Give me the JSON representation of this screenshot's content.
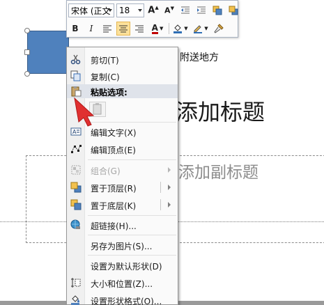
{
  "slide": {
    "title_placeholder": "添加标题",
    "subtitle_placeholder": "添加副标题",
    "shape_text": "附送地方"
  },
  "mini_toolbar": {
    "font_name": "宋体 (正文",
    "font_size": "18",
    "buttons": [
      "A▲",
      "A▼",
      "decrease-indent",
      "increase-indent",
      "bring-forward",
      "send-backward",
      "B",
      "I",
      "align-left",
      "align-center",
      "align-right",
      "A",
      "fill-color",
      "outline-color",
      "format-painter"
    ],
    "bold_label": "B",
    "italic_label": "I",
    "font_color_label": "A",
    "grow_label": "A",
    "shrink_label": "A",
    "font_color": "#c00000",
    "active_button": "align-center"
  },
  "context_menu": {
    "items": [
      {
        "label": "剪切(T)",
        "icon": "scissors-icon",
        "enabled": true
      },
      {
        "label": "复制(C)",
        "icon": "copy-icon",
        "enabled": true
      },
      {
        "label": "粘贴选项:",
        "icon": "paste-icon",
        "enabled": true,
        "header": true
      },
      {
        "label": "编辑文字(X)",
        "icon": "edit-text-icon",
        "enabled": true
      },
      {
        "label": "编辑顶点(E)",
        "icon": "edit-points-icon",
        "enabled": true
      },
      {
        "label": "组合(G)",
        "icon": "group-icon",
        "enabled": false,
        "submenu": true
      },
      {
        "label": "置于顶层(R)",
        "icon": "bring-to-front-icon",
        "enabled": true,
        "submenu": true
      },
      {
        "label": "置于底层(K)",
        "icon": "send-to-back-icon",
        "enabled": true,
        "submenu": true
      },
      {
        "label": "超链接(H)...",
        "icon": "hyperlink-icon",
        "enabled": true
      },
      {
        "label": "另存为图片(S)...",
        "icon": "",
        "enabled": true
      },
      {
        "label": "设置为默认形状(D)",
        "icon": "",
        "enabled": true
      },
      {
        "label": "大小和位置(Z)...",
        "icon": "size-position-icon",
        "enabled": true
      },
      {
        "label": "设置形状格式(O)...",
        "icon": "format-shape-icon",
        "enabled": true
      }
    ]
  },
  "colors": {
    "shape_fill": "#4f81bd",
    "highlight": "#fce19a",
    "pointer_arrow": "#e03030"
  }
}
